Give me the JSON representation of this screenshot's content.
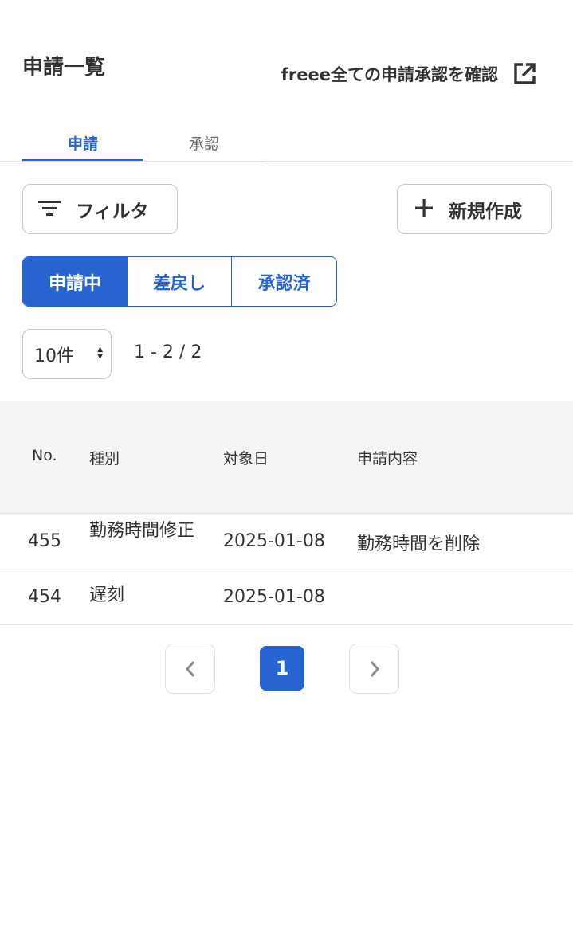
{
  "header": {
    "title": "申請一覧",
    "external_link_label": "freee全ての申請承認を確認"
  },
  "tabs": [
    {
      "label": "申請",
      "active": true
    },
    {
      "label": "承認",
      "active": false
    }
  ],
  "toolbar": {
    "filter_label": "フィルタ",
    "new_label": "新規作成"
  },
  "status_segments": [
    {
      "label": "申請中",
      "active": true
    },
    {
      "label": "差戻し",
      "active": false
    },
    {
      "label": "承認済",
      "active": false
    }
  ],
  "pagination": {
    "per_page": "10件",
    "range": "1 - 2 / 2",
    "current_page": "1"
  },
  "table": {
    "columns": [
      "No.",
      "種別",
      "対象日",
      "申請内容"
    ],
    "rows": [
      {
        "no": "455",
        "type": "勤務時間修正",
        "date": "2025-01-08",
        "content": "勤務時間を削除"
      },
      {
        "no": "454",
        "type": "遅刻",
        "date": "2025-01-08",
        "content": ""
      }
    ]
  },
  "colors": {
    "accent": "#2864d0",
    "text": "#323232",
    "header_bg": "#f5f4f4",
    "border": "#e2e2e2"
  }
}
